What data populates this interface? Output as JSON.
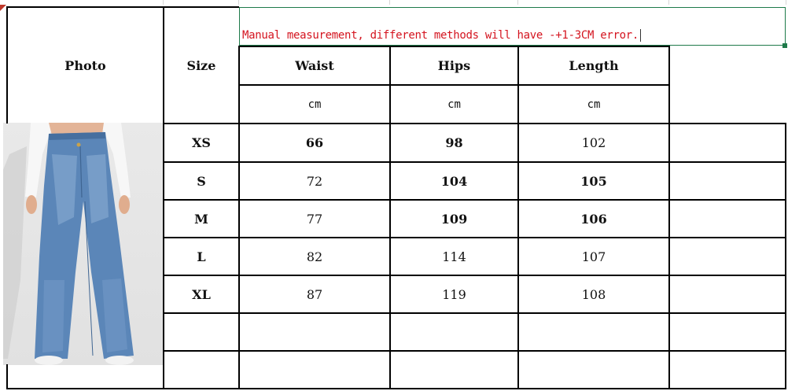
{
  "note": {
    "text": "Manual measurement, different methods will have -+1-3CM error."
  },
  "headers": {
    "photo": "Photo",
    "size": "Size",
    "waist": "Waist",
    "hips": "Hips",
    "length": "Length"
  },
  "units": {
    "waist": "cm",
    "hips": "cm",
    "length": "cm"
  },
  "rows": [
    {
      "size": "XS",
      "waist": "66",
      "hips": "98",
      "length": "102"
    },
    {
      "size": "S",
      "waist": "72",
      "hips": "104",
      "length": "105"
    },
    {
      "size": "M",
      "waist": "77",
      "hips": "109",
      "length": "106"
    },
    {
      "size": "L",
      "waist": "82",
      "hips": "114",
      "length": "107"
    },
    {
      "size": "XL",
      "waist": "87",
      "hips": "119",
      "length": "108"
    }
  ],
  "colors": {
    "note_text": "#d4141f",
    "denim": "#5b86b8",
    "selection_border": "#1e7a4a"
  },
  "photo": {
    "icon": "wide-leg-jeans-photo"
  }
}
